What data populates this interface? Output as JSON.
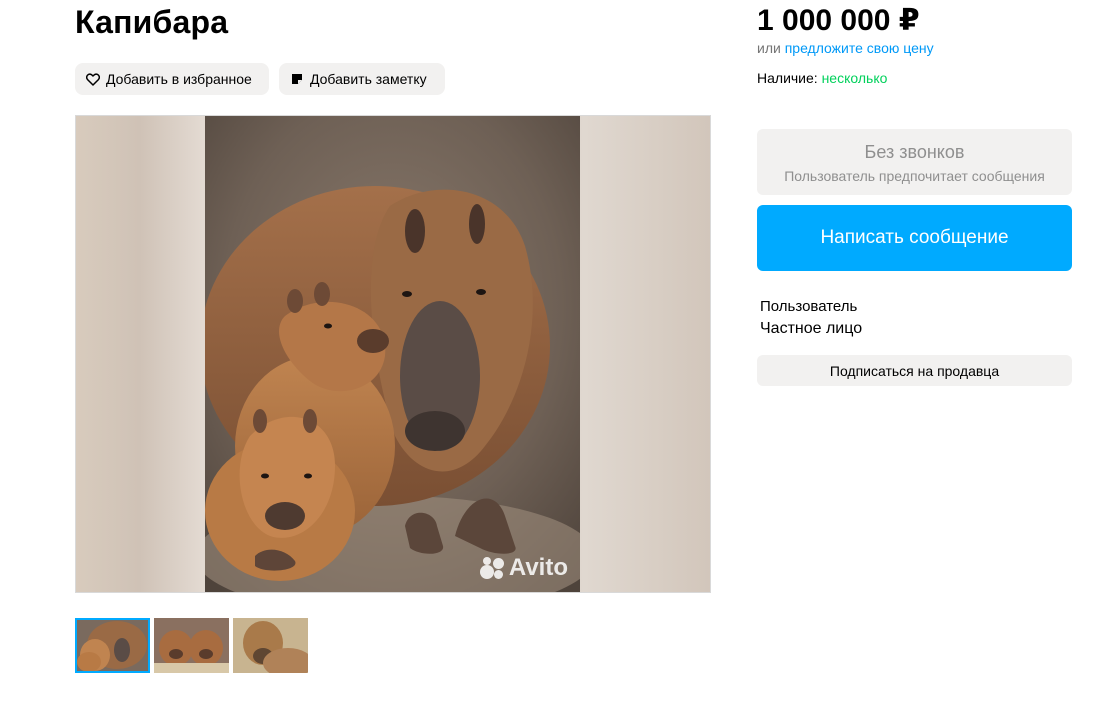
{
  "listing": {
    "title": "Капибара",
    "favorite_label": "Добавить в избранное",
    "note_label": "Добавить заметку"
  },
  "gallery": {
    "watermark": "Avito",
    "thumbnails": [
      {
        "name": "thumb-capybara-family",
        "active": true
      },
      {
        "name": "thumb-capybara-pups",
        "active": false
      },
      {
        "name": "thumb-capybara-portrait",
        "active": false
      }
    ]
  },
  "sidebar": {
    "price": "1 000 000 ₽",
    "offer_prefix": "или",
    "offer_link": "предложите свою цену",
    "stock_label": "Наличие:",
    "stock_value": "несколько",
    "no_calls_title": "Без звонков",
    "no_calls_subtitle": "Пользователь предпочитает сообщения",
    "message_button": "Написать сообщение",
    "seller_name": "Пользователь",
    "seller_type": "Частное лицо",
    "subscribe_button": "Подписаться на продавца"
  },
  "colors": {
    "accent": "#00aaff",
    "link": "#0099f7",
    "in_stock": "#02d15c",
    "chip_bg": "#f2f1f0"
  },
  "icons": {
    "favorite": "heart-icon",
    "note": "note-icon"
  }
}
